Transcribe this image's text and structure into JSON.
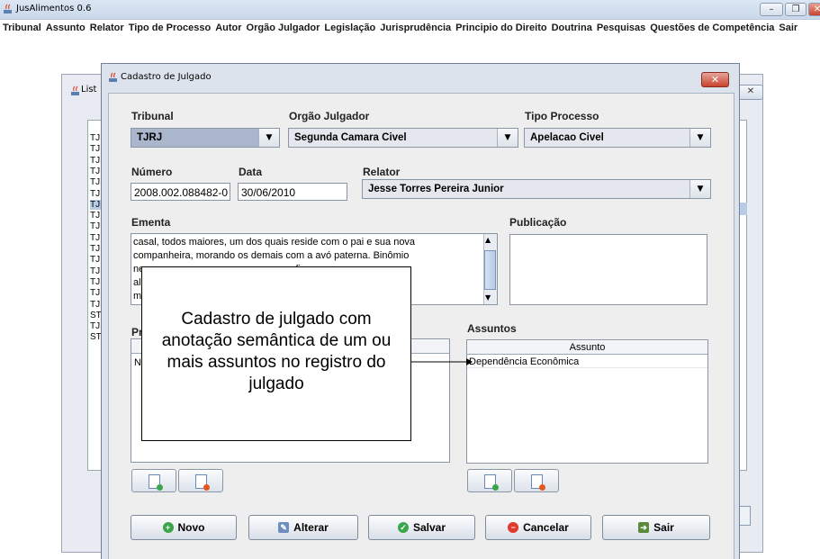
{
  "window": {
    "title": "JusAlimentos 0.6",
    "min": "–",
    "max": "❐",
    "close": "✕"
  },
  "menu": [
    "Tribunal",
    "Assunto",
    "Relator",
    "Tipo de Processo",
    "Autor",
    "Orgão Julgador",
    "Legislação",
    "Jurisprudência",
    "Principio do Direito",
    "Doutrina",
    "Pesquisas",
    "Questões de Competência",
    "Sair"
  ],
  "list_window": {
    "title": "List",
    "close": "✕",
    "rows": [
      "TJ",
      "TJ",
      "TJ",
      "TJ",
      "TJ",
      "TJ",
      "TJ",
      "TJ",
      "TJ",
      "TJ",
      "TJ",
      "TJ",
      "TJ",
      "TJ",
      "TJ",
      "TJ",
      "ST",
      "TJ",
      "ST"
    ]
  },
  "dialog": {
    "title": "Cadastro de Julgado",
    "close": "✕",
    "tribunal": {
      "label": "Tribunal",
      "value": "TJRJ"
    },
    "orgao": {
      "label": "Orgão Julgador",
      "value": "Segunda Camara Civel"
    },
    "tipo": {
      "label": "Tipo Processo",
      "value": "Apelacao Civel"
    },
    "numero": {
      "label": "Número",
      "value": "2008.002.088482-0"
    },
    "data": {
      "label": "Data",
      "value": "30/06/2010"
    },
    "relator": {
      "label": "Relator",
      "value": "Jesse Torres Pereira Junior"
    },
    "ementa": {
      "label": "Ementa",
      "lines": [
        "casal, todos maiores, um dos quais reside com o pai e sua nova",
        "companheira, morando os demais com a avó paterna. Binômio",
        "ne                                                que fixou os",
        "al                                                alário",
        "m"
      ]
    },
    "publicacao": {
      "label": "Publicação"
    },
    "partes": {
      "label": "Pr",
      "row": "N"
    },
    "assuntos": {
      "label": "Assuntos",
      "header": "Assunto",
      "row": "Dependência Econômica"
    },
    "buttons": {
      "novo": "Novo",
      "alterar": "Alterar",
      "salvar": "Salvar",
      "cancelar": "Cancelar",
      "sair": "Sair"
    }
  },
  "annotation": {
    "text": "Cadastro de julgado com anotação semântica de um ou mais assuntos no registro do julgado"
  },
  "colors": {
    "add": "#3aa64a",
    "remove": "#e2581e",
    "cancel": "#e03a2d",
    "titlebar": "#dbe6f3"
  }
}
